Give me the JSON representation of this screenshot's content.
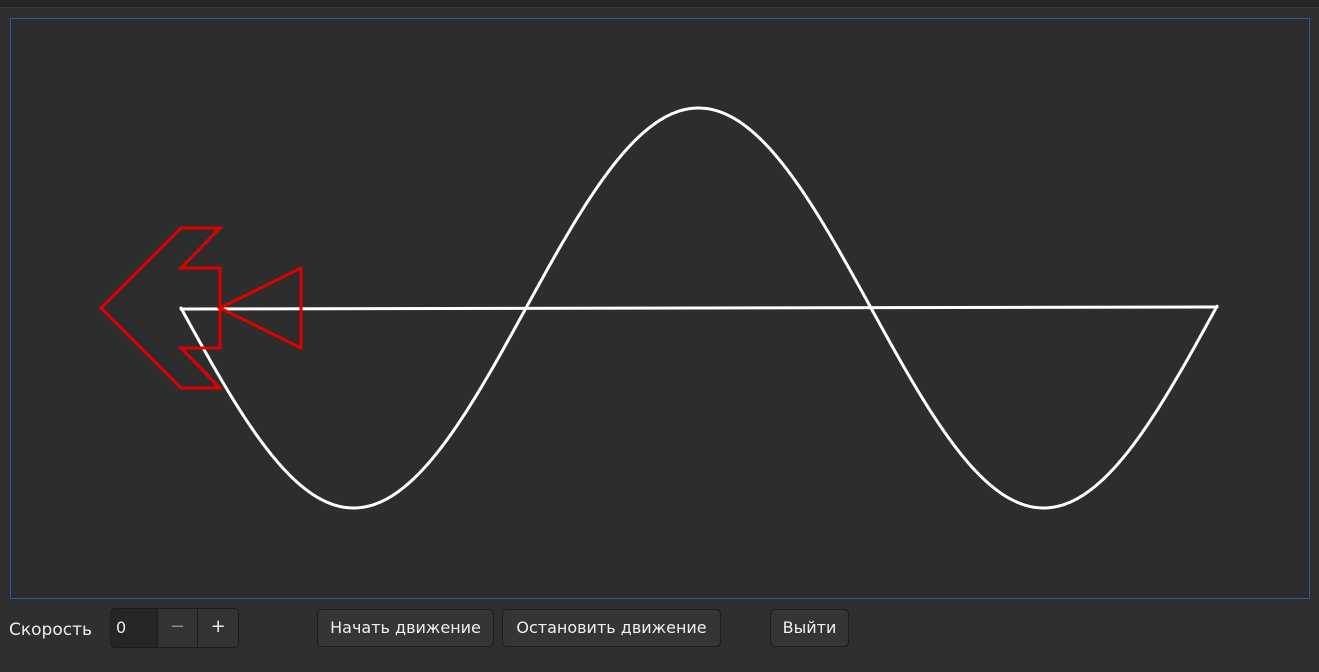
{
  "canvas": {
    "axis_color": "#ffffff",
    "arrow_color": "#e00000",
    "border_color": "#2a5aa0"
  },
  "controls": {
    "speed_label": "Скорость",
    "speed_value": "0",
    "decrement_symbol": "−",
    "increment_symbol": "+",
    "start_button": "Начать движение",
    "stop_button": "Остановить движение",
    "exit_button": "Выйти"
  }
}
